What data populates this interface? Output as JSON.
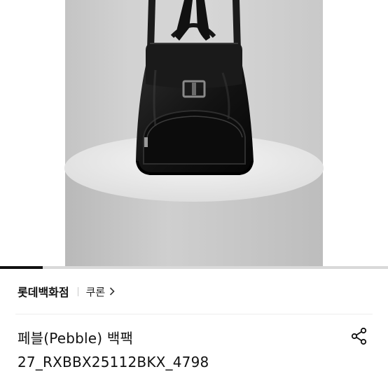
{
  "product": {
    "brand": "롯데백화점",
    "sub_brand": "쿠론",
    "title_line1": "페블(Pebble) 백팩",
    "title_line2": "27_RXBBX25112BKX_4798"
  },
  "gallery": {
    "progress_fraction": 0.11
  },
  "icons": {
    "sub_brand_arrow": "chevron-right-icon",
    "share": "share-icon"
  },
  "colors": {
    "progress_fill": "#111111",
    "progress_track": "#d9d9d9",
    "text": "#111111"
  }
}
